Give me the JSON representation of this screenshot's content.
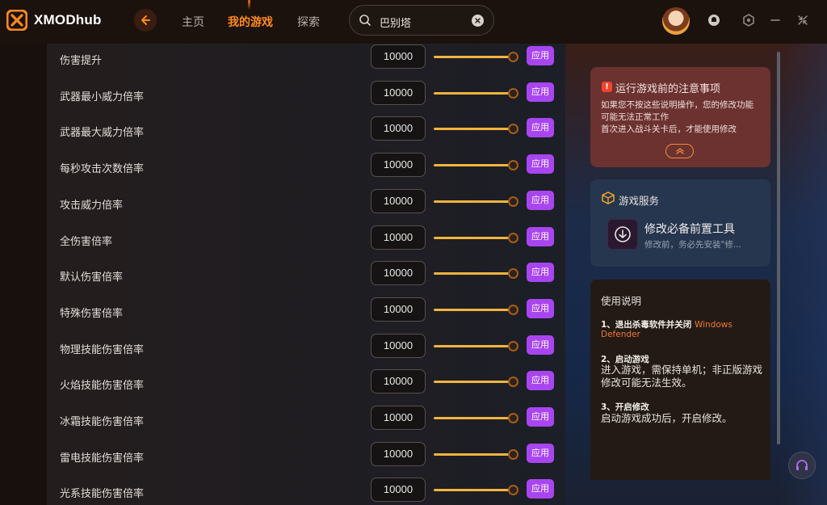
{
  "app": {
    "title": "XMODhub"
  },
  "colors": {
    "accent": "#ff8a1f",
    "apply": "#a845f0",
    "slider": "#f5b43c",
    "notice_bg": "#6b3230"
  },
  "nav": {
    "home": "主页",
    "my_games": "我的游戏",
    "explore": "探索",
    "active": "my_games"
  },
  "search": {
    "value": "巴别塔",
    "icon": "search-icon"
  },
  "topbar_icons": [
    "avatar",
    "notification-icon",
    "settings-hex-icon",
    "minimize-icon",
    "close-icon"
  ],
  "settings": {
    "apply_label": "应用",
    "rows": [
      {
        "label": "伤害提升",
        "value": "10000",
        "slider_fraction": 1.0
      },
      {
        "label": "武器最小威力倍率",
        "value": "10000",
        "slider_fraction": 1.0
      },
      {
        "label": "武器最大威力倍率",
        "value": "10000",
        "slider_fraction": 1.0
      },
      {
        "label": "每秒攻击次数倍率",
        "value": "10000",
        "slider_fraction": 1.0
      },
      {
        "label": "攻击威力倍率",
        "value": "10000",
        "slider_fraction": 1.0
      },
      {
        "label": "全伤害倍率",
        "value": "10000",
        "slider_fraction": 1.0
      },
      {
        "label": "默认伤害倍率",
        "value": "10000",
        "slider_fraction": 1.0
      },
      {
        "label": "特殊伤害倍率",
        "value": "10000",
        "slider_fraction": 1.0
      },
      {
        "label": "物理技能伤害倍率",
        "value": "10000",
        "slider_fraction": 1.0
      },
      {
        "label": "火焰技能伤害倍率",
        "value": "10000",
        "slider_fraction": 1.0
      },
      {
        "label": "冰霜技能伤害倍率",
        "value": "10000",
        "slider_fraction": 1.0
      },
      {
        "label": "雷电技能伤害倍率",
        "value": "10000",
        "slider_fraction": 1.0
      },
      {
        "label": "光系技能伤害倍率",
        "value": "10000",
        "slider_fraction": 1.0
      }
    ]
  },
  "notice": {
    "title": "运行游戏前的注意事项",
    "line1": "如果您不按这些说明操作，您的修改功能",
    "line2": "可能无法正常工作",
    "line3": "首次进入战斗关卡后，才能使用修改"
  },
  "service": {
    "header": "游戏服务",
    "tool_name": "修改必备前置工具",
    "tool_desc": "修改前，务必先安装\"修..."
  },
  "guide": {
    "header": "使用说明",
    "step1_title": "1、退出杀毒软件并关闭",
    "step1_highlight": "Windows",
    "step1_highlight2": "Defender",
    "step2_title": "2、启动游戏",
    "step2_body": "进入游戏，需保持单机；非正版游戏修改可能无法生效。",
    "step3_title": "3、开启修改",
    "step3_body": "启动游戏成功后，开启修改。"
  }
}
